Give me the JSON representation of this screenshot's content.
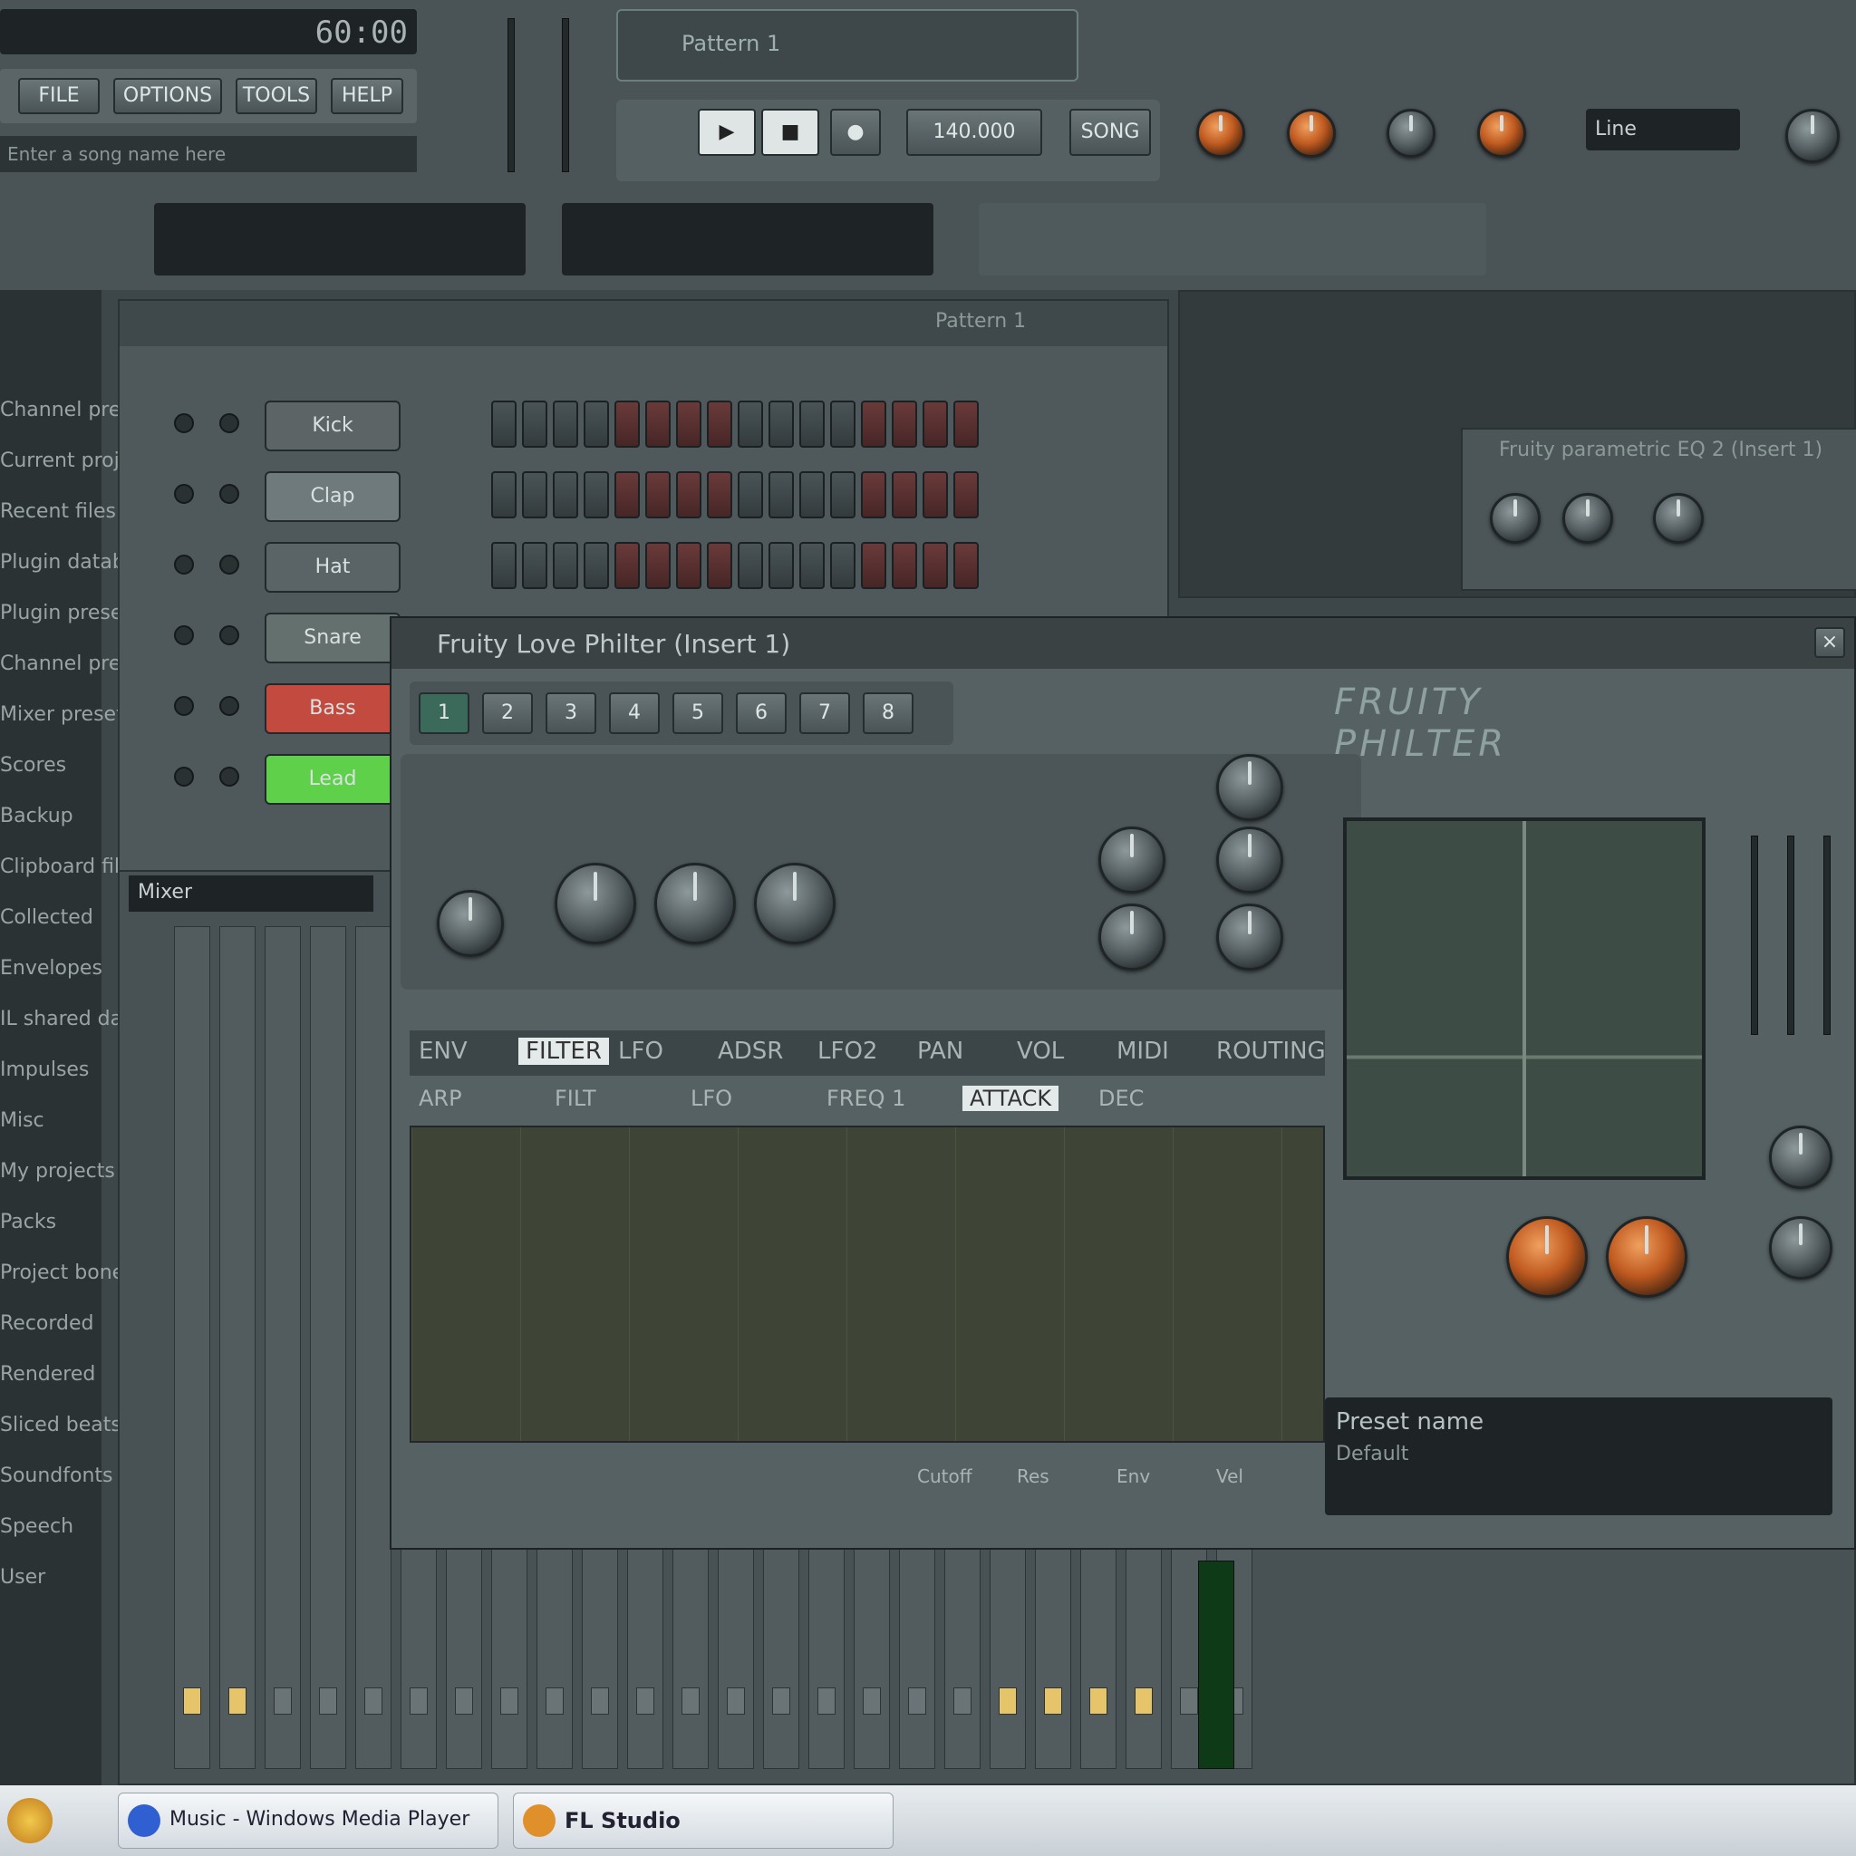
{
  "window": {
    "title": "FL Studio"
  },
  "toolbar": {
    "time_display": "60:00",
    "menu_items": [
      "FILE",
      "OPTIONS",
      "TOOLS",
      "HELP"
    ],
    "hint_bar": "Enter a song name here",
    "pattern_label": "Pattern 1",
    "tempo_label": "140.000",
    "transport": {
      "play": "▶",
      "stop": "■",
      "record": "●"
    },
    "song_mode": "SONG",
    "snap_label": "Line"
  },
  "channel_rack": {
    "title": "Pattern 1",
    "channels": [
      {
        "name": "Kick",
        "color": "#5c6466"
      },
      {
        "name": "Clap",
        "color": "#6e7a7c"
      },
      {
        "name": "Hat",
        "color": "#5a6466"
      },
      {
        "name": "Snare",
        "color": "#63706e"
      },
      {
        "name": "Bass",
        "color": "#c24a3e"
      },
      {
        "name": "Lead",
        "color": "#5fd04a"
      }
    ],
    "step_count": 16
  },
  "plugin_window": {
    "title": "Fruity Love Philter (Insert 1)",
    "logo": "FRUITY PHILTER",
    "preset_label": "Preset name",
    "preset_value": "Default",
    "tabs": [
      "ENV",
      "FILTER",
      "LFO",
      "ADSR",
      "LFO2",
      "PAN",
      "VOL",
      "MIDI",
      "ROUTING"
    ],
    "subtabs": [
      "ARP",
      "FILT",
      "LFO",
      "FREQ 1",
      "ATTACK",
      "DEC"
    ],
    "footer_items": [
      "Cutoff",
      "Res",
      "Env",
      "Vel"
    ],
    "section_labels": [
      "1",
      "2",
      "3",
      "4",
      "5",
      "6",
      "7",
      "8"
    ]
  },
  "browser": {
    "items": [
      "Channel presets",
      "Current project",
      "Recent files",
      "Plugin database",
      "Plugin presets",
      "Channel presets",
      "Mixer presets",
      "Scores",
      "Backup",
      "Clipboard files",
      "Collected",
      "Envelopes",
      "IL shared data",
      "Impulses",
      "Misc",
      "My projects",
      "Packs",
      "Project bones",
      "Recorded",
      "Rendered",
      "Sliced beats",
      "Soundfonts",
      "Speech",
      "User"
    ]
  },
  "mixer": {
    "title": "Mixer",
    "strip_count": 24
  },
  "effect_panel": {
    "title": "Fruity parametric EQ 2 (Insert 1)"
  },
  "taskbar": {
    "start_icon": "windows-icon",
    "items": [
      {
        "label": "Music - Windows Media Player",
        "icon": "media-icon"
      },
      {
        "label": "FL Studio",
        "icon": "fl-icon"
      }
    ]
  }
}
